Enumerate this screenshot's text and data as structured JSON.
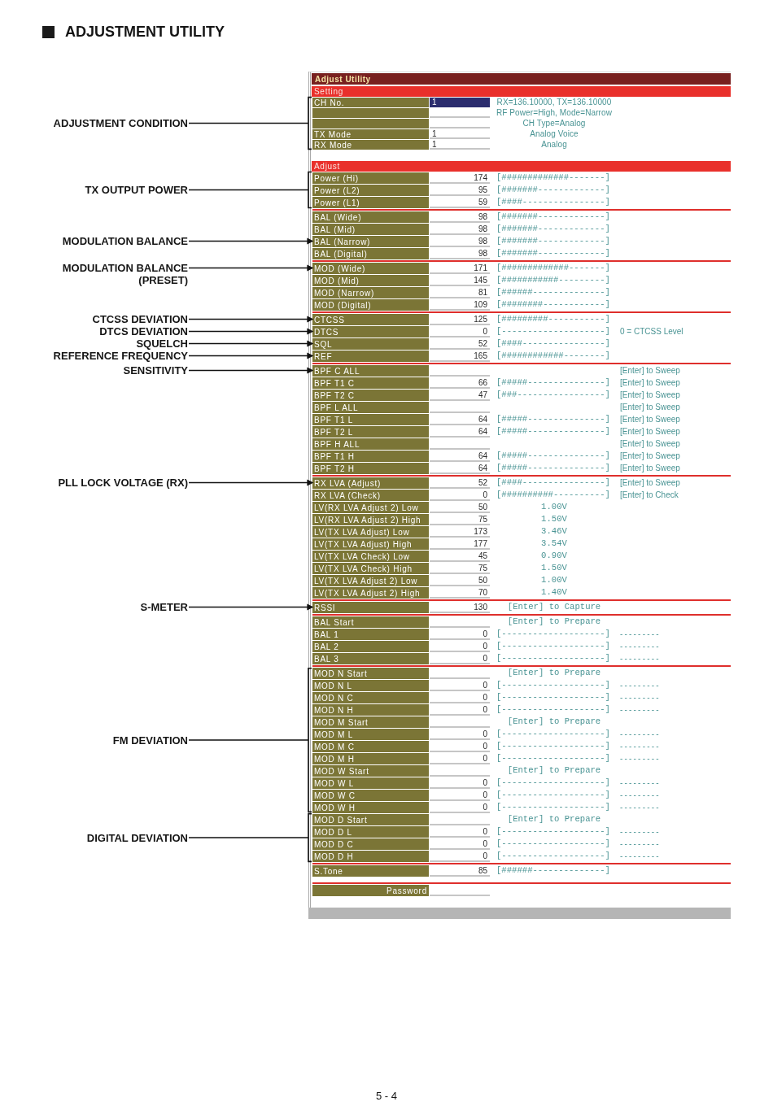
{
  "heading": {
    "title": "ADJUSTMENT UTILITY"
  },
  "window": {
    "title": "Adjust Utility",
    "sections": [
      {
        "kind": "setting",
        "title": "Setting",
        "groups": [
          {
            "blocks": [
              {
                "callout": "ADJUSTMENT CONDITION",
                "rows": [
                  {
                    "label": "CH No.",
                    "value": "1",
                    "selected": true,
                    "status": "RX=136.10000, TX=136.10000"
                  },
                  {
                    "selected": false,
                    "status": "RF Power=High, Mode=Narrow"
                  },
                  {
                    "selected": false,
                    "status": "CH Type=Analog"
                  },
                  {
                    "label": "TX Mode",
                    "value": "1",
                    "selected": false,
                    "status": "Analog Voice"
                  },
                  {
                    "label": "RX Mode",
                    "value": "1",
                    "selected": false,
                    "status": "Analog"
                  }
                ]
              }
            ]
          }
        ]
      },
      {
        "kind": "adjust",
        "title": "Adjust",
        "groups": [
          {
            "blocks": [
              {
                "callout": "TX OUTPUT POWER",
                "rows": [
                  {
                    "label": "Power (Hi)",
                    "value": "174",
                    "selected": false,
                    "bar": "[#############-------]"
                  },
                  {
                    "label": "Power (L2)",
                    "value": "95",
                    "selected": false,
                    "bar": "[#######-------------]"
                  },
                  {
                    "label": "Power (L1)",
                    "value": "59",
                    "selected": false,
                    "bar": "[####----------------]"
                  }
                ]
              }
            ]
          },
          {
            "blocks": [
              {
                "rows": [
                  {
                    "label": "BAL (Wide)",
                    "value": "98",
                    "selected": false,
                    "bar": "[#######-------------]"
                  },
                  {
                    "label": "BAL (Mid)",
                    "value": "98",
                    "selected": false,
                    "bar": "[#######-------------]"
                  },
                  {
                    "label": "BAL (Narrow)",
                    "value": "98",
                    "selected": false,
                    "bar": "[#######-------------]",
                    "callout": "MODULATION BALANCE"
                  },
                  {
                    "label": "BAL (Digital)",
                    "value": "98",
                    "selected": false,
                    "bar": "[#######-------------]"
                  }
                ]
              }
            ]
          },
          {
            "blocks": [
              {
                "rows": [
                  {
                    "label": "MOD (Wide)",
                    "value": "171",
                    "selected": false,
                    "bar": "[#############-------]",
                    "callout": "MODULATION BALANCE (PRESET)"
                  },
                  {
                    "label": "MOD (Mid)",
                    "value": "145",
                    "selected": false,
                    "bar": "[###########---------]"
                  },
                  {
                    "label": "MOD (Narrow)",
                    "value": "81",
                    "selected": false,
                    "bar": "[######--------------]"
                  },
                  {
                    "label": "MOD (Digital)",
                    "value": "109",
                    "selected": false,
                    "bar": "[########------------]"
                  }
                ]
              }
            ]
          },
          {
            "blocks": [
              {
                "rows": [
                  {
                    "label": "CTCSS",
                    "value": "125",
                    "selected": false,
                    "bar": "[#########-----------]",
                    "callout": "CTCSS DEVIATION"
                  },
                  {
                    "label": "DTCS",
                    "value": "0",
                    "selected": false,
                    "bar": "[--------------------]",
                    "note": "0 = CTCSS Level",
                    "callout": "DTCS DEVIATION"
                  },
                  {
                    "label": "SQL",
                    "value": "52",
                    "selected": false,
                    "bar": "[####----------------]",
                    "callout": "SQUELCH"
                  },
                  {
                    "label": "REF",
                    "value": "165",
                    "selected": false,
                    "bar": "[############--------]",
                    "callout": "REFERENCE FREQUENCY"
                  }
                ]
              }
            ]
          },
          {
            "blocks": [
              {
                "rows": [
                  {
                    "label": "BPF C ALL",
                    "selected": false,
                    "note": "[Enter] to Sweep",
                    "callout": "SENSITIVITY"
                  },
                  {
                    "label": "BPF T1 C",
                    "value": "66",
                    "selected": false,
                    "bar": "[#####---------------]",
                    "note": "[Enter] to Sweep"
                  },
                  {
                    "label": "BPF T2 C",
                    "value": "47",
                    "selected": false,
                    "bar": "[###-----------------]",
                    "note": "[Enter] to Sweep"
                  },
                  {
                    "label": "BPF L ALL",
                    "selected": false,
                    "note": "[Enter] to Sweep"
                  },
                  {
                    "label": "BPF T1 L",
                    "value": "64",
                    "selected": false,
                    "bar": "[#####---------------]",
                    "note": "[Enter] to Sweep"
                  },
                  {
                    "label": "BPF T2 L",
                    "value": "64",
                    "selected": false,
                    "bar": "[#####---------------]",
                    "note": "[Enter] to Sweep"
                  },
                  {
                    "label": "BPF H ALL",
                    "selected": false,
                    "note": "[Enter] to Sweep"
                  },
                  {
                    "label": "BPF T1 H",
                    "value": "64",
                    "selected": false,
                    "bar": "[#####---------------]",
                    "note": "[Enter] to Sweep"
                  },
                  {
                    "label": "BPF T2 H",
                    "value": "64",
                    "selected": false,
                    "bar": "[#####---------------]",
                    "note": "[Enter] to Sweep"
                  }
                ]
              }
            ]
          },
          {
            "blocks": [
              {
                "rows": [
                  {
                    "label": "RX LVA (Adjust)",
                    "value": "52",
                    "selected": false,
                    "bar": "[####----------------]",
                    "note": "[Enter] to Sweep",
                    "callout": "PLL LOCK VOLTAGE (RX)"
                  },
                  {
                    "label": "RX LVA (Check)",
                    "value": "0",
                    "selected": false,
                    "bar": "[##########----------]",
                    "note": "[Enter] to Check"
                  },
                  {
                    "label": "LV(RX LVA Adjust 2) Low",
                    "value": "50",
                    "selected": false,
                    "info": "1.00V"
                  },
                  {
                    "label": "LV(RX LVA Adjust 2) High",
                    "value": "75",
                    "selected": false,
                    "info": "1.50V"
                  },
                  {
                    "label": "LV(TX LVA Adjust) Low",
                    "value": "173",
                    "selected": false,
                    "info": "3.46V"
                  },
                  {
                    "label": "LV(TX LVA Adjust) High",
                    "value": "177",
                    "selected": false,
                    "info": "3.54V"
                  },
                  {
                    "label": "LV(TX LVA Check) Low",
                    "value": "45",
                    "selected": false,
                    "info": "0.90V"
                  },
                  {
                    "label": "LV(TX LVA Check) High",
                    "value": "75",
                    "selected": false,
                    "info": "1.50V"
                  },
                  {
                    "label": "LV(TX LVA Adjust 2) Low",
                    "value": "50",
                    "selected": false,
                    "info": "1.00V"
                  },
                  {
                    "label": "LV(TX LVA Adjust 2) High",
                    "value": "70",
                    "selected": false,
                    "info": "1.40V"
                  }
                ]
              }
            ]
          },
          {
            "blocks": [
              {
                "rows": [
                  {
                    "label": "RSSI",
                    "value": "130",
                    "selected": false,
                    "info": "[Enter] to Capture",
                    "callout": "S-METER"
                  }
                ]
              }
            ]
          },
          {
            "blocks": [
              {
                "rows": [
                  {
                    "label": "BAL Start",
                    "selected": false,
                    "info": "[Enter] to Prepare"
                  },
                  {
                    "label": "BAL 1",
                    "value": "0",
                    "selected": false,
                    "bar": "[--------------------]",
                    "result": "---------"
                  },
                  {
                    "label": "BAL 2",
                    "value": "0",
                    "selected": false,
                    "bar": "[--------------------]",
                    "result": "---------"
                  },
                  {
                    "label": "BAL 3",
                    "value": "0",
                    "selected": false,
                    "bar": "[--------------------]",
                    "result": "---------"
                  }
                ]
              }
            ]
          },
          {
            "blocks": [
              {
                "callout": "FM DEVIATION",
                "rows": [
                  {
                    "label": "MOD N Start",
                    "selected": false,
                    "info": "[Enter] to Prepare"
                  },
                  {
                    "label": "MOD N L",
                    "value": "0",
                    "selected": false,
                    "bar": "[--------------------]",
                    "result": "---------"
                  },
                  {
                    "label": "MOD N C",
                    "value": "0",
                    "selected": false,
                    "bar": "[--------------------]",
                    "result": "---------"
                  },
                  {
                    "label": "MOD N H",
                    "value": "0",
                    "selected": false,
                    "bar": "[--------------------]",
                    "result": "---------"
                  },
                  {
                    "label": "MOD M Start",
                    "selected": false,
                    "info": "[Enter] to Prepare"
                  },
                  {
                    "label": "MOD M L",
                    "value": "0",
                    "selected": false,
                    "bar": "[--------------------]",
                    "result": "---------"
                  },
                  {
                    "label": "MOD M C",
                    "value": "0",
                    "selected": false,
                    "bar": "[--------------------]",
                    "result": "---------"
                  },
                  {
                    "label": "MOD M H",
                    "value": "0",
                    "selected": false,
                    "bar": "[--------------------]",
                    "result": "---------"
                  },
                  {
                    "label": "MOD W Start",
                    "selected": false,
                    "info": "[Enter] to Prepare"
                  },
                  {
                    "label": "MOD W L",
                    "value": "0",
                    "selected": false,
                    "bar": "[--------------------]",
                    "result": "---------"
                  },
                  {
                    "label": "MOD W C",
                    "value": "0",
                    "selected": false,
                    "bar": "[--------------------]",
                    "result": "---------"
                  },
                  {
                    "label": "MOD W H",
                    "value": "0",
                    "selected": false,
                    "bar": "[--------------------]",
                    "result": "---------"
                  }
                ]
              },
              {
                "callout": "DIGITAL DEVIATION",
                "rows": [
                  {
                    "label": "MOD D Start",
                    "selected": false,
                    "info": "[Enter] to Prepare"
                  },
                  {
                    "label": "MOD D L",
                    "value": "0",
                    "selected": false,
                    "bar": "[--------------------]",
                    "result": "---------"
                  },
                  {
                    "label": "MOD D C",
                    "value": "0",
                    "selected": false,
                    "bar": "[--------------------]",
                    "result": "---------"
                  },
                  {
                    "label": "MOD D H",
                    "value": "0",
                    "selected": false,
                    "bar": "[--------------------]",
                    "result": "---------"
                  }
                ]
              }
            ]
          },
          {
            "blocks": [
              {
                "rows": [
                  {
                    "label": "S.Tone",
                    "value": "85",
                    "selected": false,
                    "bar": "[######--------------]"
                  }
                ]
              }
            ]
          }
        ]
      }
    ],
    "password": {
      "label": "Password",
      "selected": false
    }
  },
  "page_number": "5 - 4"
}
